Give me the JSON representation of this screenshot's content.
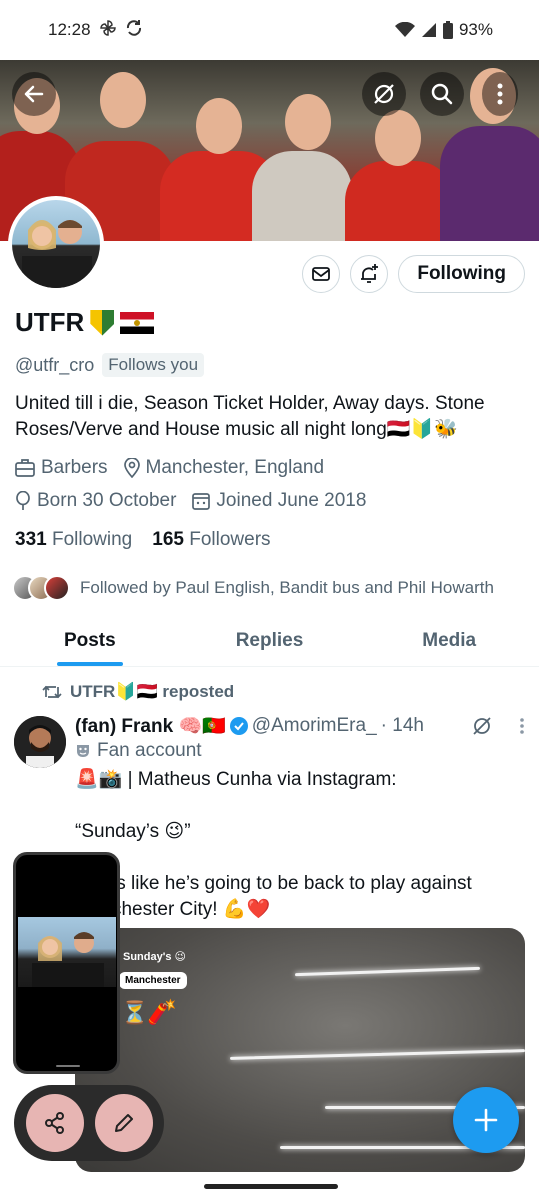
{
  "status_bar": {
    "time": "12:28",
    "battery": "93%"
  },
  "profile": {
    "name": "UTFR",
    "handle": "@utfr_cro",
    "follows_you": "Follows you",
    "bio": "United till i die, Season Ticket Holder, Away days. Stone Roses/Verve and House music all night long🇾🇪🔰🐝",
    "occupation": "Barbers",
    "location": "Manchester, England",
    "born": "Born 30 October",
    "joined": "Joined June 2018",
    "following_count": "331",
    "following_label": "Following",
    "followers_count": "165",
    "followers_label": "Followers",
    "followed_by": "Followed by Paul English, Bandit bus and Phil Howarth",
    "follow_button": "Following"
  },
  "tabs": [
    {
      "label": "Posts",
      "active": true
    },
    {
      "label": "Replies",
      "active": false
    },
    {
      "label": "Media",
      "active": false
    }
  ],
  "tweet": {
    "repost_label": "UTFR🔰🇾🇪 reposted",
    "author": "(fan) Frank 🧠🇵🇹",
    "handle": "@AmorimEra_",
    "time": "· 14h",
    "label": "Fan account",
    "text_line1": "🚨📸 | Matheus Cunha via Instagram:",
    "text_line2": "“Sunday’s 😉”",
    "text_line3": "Looks like he’s going to be back to play against Manchester City! 💪❤️",
    "media_caption": "Sunday's 😉",
    "media_location": "Manchester"
  },
  "colors": {
    "accent": "#1d9bf0",
    "text_secondary": "#536471",
    "fab_small": "#e7b5b3"
  }
}
